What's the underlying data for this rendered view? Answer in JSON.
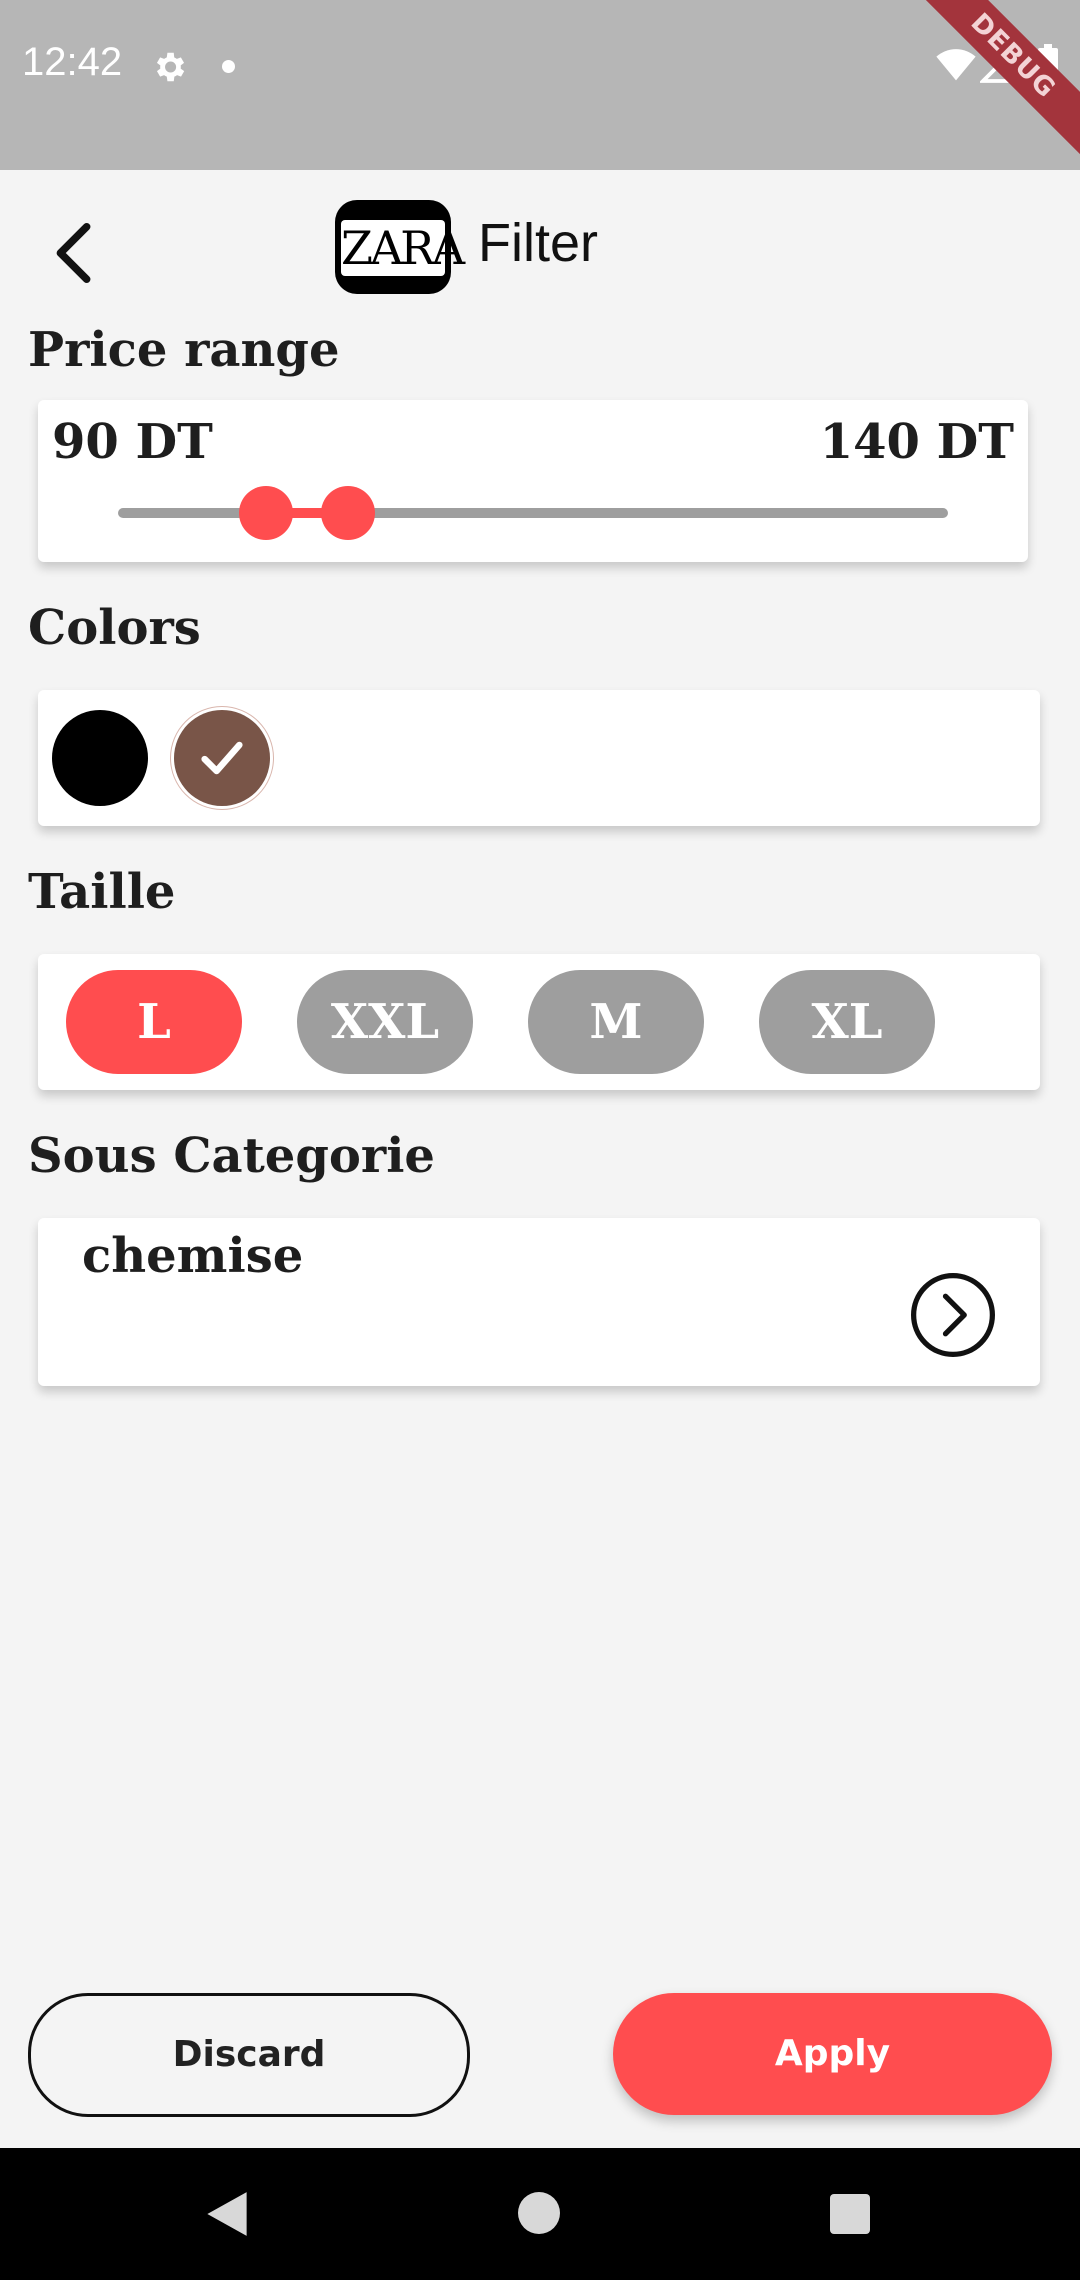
{
  "status_bar": {
    "time": "12:42",
    "debug_label": "DEBUG",
    "icons": [
      "gear-icon",
      "notification-dot-icon",
      "wifi-icon",
      "signal-icon",
      "battery-icon"
    ]
  },
  "app_bar": {
    "title": "Filter",
    "logo_text": "ZARA",
    "back_icon": "chevron-left-icon"
  },
  "price_range": {
    "title": "Price range",
    "min_label": "90 DT",
    "max_label": "140 DT",
    "min_value_fraction": 0.18,
    "max_value_fraction": 0.28,
    "accent_color": "#ff4d4f",
    "track_color": "#9e9e9e"
  },
  "colors": {
    "title": "Colors",
    "swatches": [
      {
        "color": "#000000",
        "selected": false
      },
      {
        "color": "#795548",
        "selected": true
      }
    ]
  },
  "taille": {
    "title": "Taille",
    "sizes": [
      {
        "label": "L",
        "selected": true
      },
      {
        "label": "XXL",
        "selected": false
      },
      {
        "label": "M",
        "selected": false
      },
      {
        "label": "XL",
        "selected": false
      }
    ],
    "selected_color": "#ff4d4f",
    "unselected_color": "#9e9e9e"
  },
  "sous_categorie": {
    "title": "Sous Categorie",
    "value": "chemise",
    "arrow_icon": "chevron-right-circle-icon"
  },
  "actions": {
    "discard_label": "Discard",
    "apply_label": "Apply",
    "apply_color": "#ff4d4f"
  },
  "nav_bar": {
    "icons": [
      "nav-back-icon",
      "nav-home-icon",
      "nav-recents-icon"
    ]
  }
}
